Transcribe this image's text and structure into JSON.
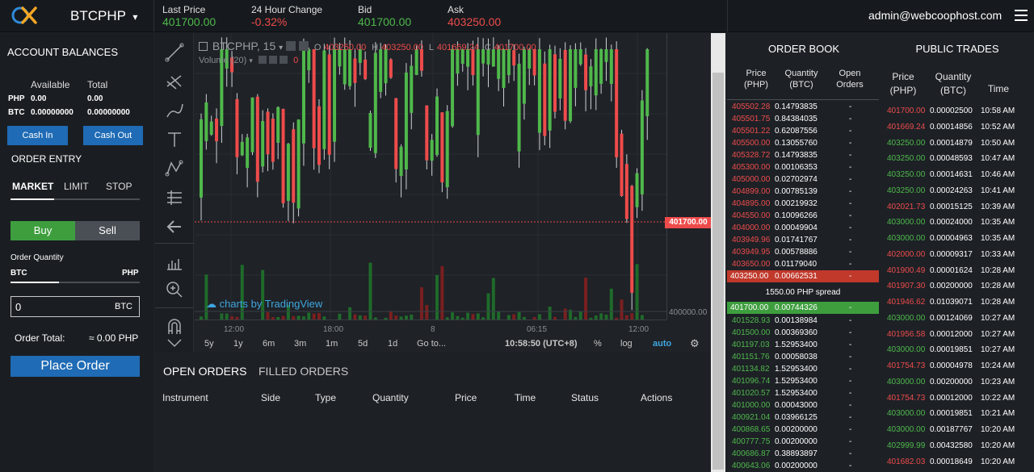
{
  "header": {
    "pair": "BTCPHP",
    "caret": "▾",
    "last_price_label": "Last Price",
    "last_price": "401700.00",
    "change_label": "24 Hour Change",
    "change": "-0.32%",
    "bid_label": "Bid",
    "bid": "401700.00",
    "ask_label": "Ask",
    "ask": "403250.00",
    "user": "admin@webcoophost.com"
  },
  "balances": {
    "title": "ACCOUNT BALANCES",
    "col_available": "Available",
    "col_total": "Total",
    "rows": [
      {
        "asset": "PHP",
        "available": "0.00",
        "total": "0.00"
      },
      {
        "asset": "BTC",
        "available": "0.00000000",
        "total": "0.00000000"
      }
    ],
    "cash_in": "Cash In",
    "cash_out": "Cash Out"
  },
  "order_entry": {
    "title": "ORDER ENTRY",
    "tabs": [
      "MARKET",
      "LIMIT",
      "STOP"
    ],
    "buy": "Buy",
    "sell": "Sell",
    "qty_label": "Order Quantity",
    "from": "BTC",
    "to": "PHP",
    "qty_value": "0",
    "qty_unit": "BTC",
    "total_label": "Order Total:",
    "total_value": "≈ 0.00 PHP",
    "place": "Place Order"
  },
  "chart": {
    "symbol": "BTCPHP, 15",
    "ohlc": {
      "o_label": "O",
      "o": "403250.00",
      "h_label": "H",
      "h": "403250.00",
      "l_label": "L",
      "l": "401669.24",
      "c_label": "C",
      "c": "401700.00"
    },
    "volume_label": "Volume (20)",
    "volume_value": "0",
    "last_price_tag": "401700.00",
    "scale_label": "400000.00",
    "time_labels": [
      "12:00",
      "18:00",
      "8",
      "06:15",
      "12:00"
    ],
    "ranges": [
      "5y",
      "1y",
      "6m",
      "3m",
      "1m",
      "5d",
      "1d",
      "Go to..."
    ],
    "clock": "10:58:50 (UTC+8)",
    "pct": "%",
    "log": "log",
    "auto": "auto",
    "watermark": "charts by TradingView"
  },
  "chart_colors": {
    "up": "#4fb84b",
    "down": "#ee4b4b"
  },
  "orders": {
    "tabs": [
      "OPEN ORDERS",
      "FILLED ORDERS"
    ],
    "columns": [
      "Instrument",
      "Side",
      "Type",
      "Quantity",
      "Price",
      "Time",
      "Status",
      "Actions"
    ]
  },
  "order_book": {
    "title": "ORDER BOOK",
    "columns": [
      "Price\n(PHP)",
      "Quantity\n(BTC)",
      "Open\nOrders"
    ],
    "asks": [
      {
        "price": "405502.28",
        "qty": "0.14793835",
        "open": "-"
      },
      {
        "price": "405501.75",
        "qty": "0.84384035",
        "open": "-"
      },
      {
        "price": "405501.22",
        "qty": "0.62087556",
        "open": "-"
      },
      {
        "price": "405500.00",
        "qty": "0.13055760",
        "open": "-"
      },
      {
        "price": "405328.72",
        "qty": "0.14793835",
        "open": "-"
      },
      {
        "price": "405300.00",
        "qty": "0.00106353",
        "open": "-"
      },
      {
        "price": "405000.00",
        "qty": "0.02702974",
        "open": "-"
      },
      {
        "price": "404899.00",
        "qty": "0.00785139",
        "open": "-"
      },
      {
        "price": "404895.00",
        "qty": "0.00219932",
        "open": "-"
      },
      {
        "price": "404550.00",
        "qty": "0.10096266",
        "open": "-"
      },
      {
        "price": "404000.00",
        "qty": "0.00049904",
        "open": "-"
      },
      {
        "price": "403949.96",
        "qty": "0.01741767",
        "open": "-"
      },
      {
        "price": "403949.95",
        "qty": "0.00578886",
        "open": "-"
      },
      {
        "price": "403650.00",
        "qty": "0.01179040",
        "open": "-"
      }
    ],
    "best_ask": {
      "price": "403250.00",
      "qty": "0.00662531",
      "open": "-"
    },
    "spread": "1550.00 PHP spread",
    "best_bid": {
      "price": "401700.00",
      "qty": "0.00744326",
      "open": "-"
    },
    "bids": [
      {
        "price": "401528.93",
        "qty": "0.00138984",
        "open": "-"
      },
      {
        "price": "401500.00",
        "qty": "0.00369360",
        "open": "-"
      },
      {
        "price": "401197.03",
        "qty": "1.52953400",
        "open": "-"
      },
      {
        "price": "401151.76",
        "qty": "0.00058038",
        "open": "-"
      },
      {
        "price": "401134.82",
        "qty": "1.52953400",
        "open": "-"
      },
      {
        "price": "401096.74",
        "qty": "1.52953400",
        "open": "-"
      },
      {
        "price": "401020.57",
        "qty": "1.52953400",
        "open": "-"
      },
      {
        "price": "401000.00",
        "qty": "0.00043000",
        "open": "-"
      },
      {
        "price": "400921.04",
        "qty": "0.03966125",
        "open": "-"
      },
      {
        "price": "400868.65",
        "qty": "0.00200000",
        "open": "-"
      },
      {
        "price": "400777.75",
        "qty": "0.00200000",
        "open": "-"
      },
      {
        "price": "400686.87",
        "qty": "0.38893897",
        "open": "-"
      },
      {
        "price": "400643.06",
        "qty": "0.00200000",
        "open": "-"
      }
    ]
  },
  "public_trades": {
    "title": "PUBLIC TRADES",
    "columns": [
      "Price\n(PHP)",
      "Quantity\n(BTC)",
      "Time"
    ],
    "rows": [
      {
        "price": "401700.00",
        "qty": "0.00002500",
        "time": "10:58 AM",
        "side": "sell"
      },
      {
        "price": "401669.24",
        "qty": "0.00014856",
        "time": "10:52 AM",
        "side": "sell"
      },
      {
        "price": "403250.00",
        "qty": "0.00014879",
        "time": "10:50 AM",
        "side": "buy"
      },
      {
        "price": "403250.00",
        "qty": "0.00048593",
        "time": "10:47 AM",
        "side": "buy"
      },
      {
        "price": "403250.00",
        "qty": "0.00014631",
        "time": "10:46 AM",
        "side": "buy"
      },
      {
        "price": "403250.00",
        "qty": "0.00024263",
        "time": "10:41 AM",
        "side": "buy"
      },
      {
        "price": "402021.73",
        "qty": "0.00015125",
        "time": "10:39 AM",
        "side": "sell"
      },
      {
        "price": "403000.00",
        "qty": "0.00024000",
        "time": "10:35 AM",
        "side": "buy"
      },
      {
        "price": "403000.00",
        "qty": "0.00004963",
        "time": "10:35 AM",
        "side": "buy"
      },
      {
        "price": "402000.00",
        "qty": "0.00009317",
        "time": "10:33 AM",
        "side": "sell"
      },
      {
        "price": "401900.49",
        "qty": "0.00001624",
        "time": "10:28 AM",
        "side": "sell"
      },
      {
        "price": "401907.30",
        "qty": "0.00200000",
        "time": "10:28 AM",
        "side": "sell"
      },
      {
        "price": "401946.62",
        "qty": "0.01039071",
        "time": "10:28 AM",
        "side": "sell"
      },
      {
        "price": "403000.00",
        "qty": "0.00124069",
        "time": "10:27 AM",
        "side": "buy"
      },
      {
        "price": "401956.58",
        "qty": "0.00012000",
        "time": "10:27 AM",
        "side": "sell"
      },
      {
        "price": "403000.00",
        "qty": "0.00019851",
        "time": "10:27 AM",
        "side": "buy"
      },
      {
        "price": "401754.73",
        "qty": "0.00004978",
        "time": "10:24 AM",
        "side": "sell"
      },
      {
        "price": "403000.00",
        "qty": "0.00200000",
        "time": "10:23 AM",
        "side": "buy"
      },
      {
        "price": "401754.73",
        "qty": "0.00012000",
        "time": "10:22 AM",
        "side": "sell"
      },
      {
        "price": "403000.00",
        "qty": "0.00019851",
        "time": "10:21 AM",
        "side": "buy"
      },
      {
        "price": "403000.00",
        "qty": "0.00187767",
        "time": "10:20 AM",
        "side": "buy"
      },
      {
        "price": "402999.99",
        "qty": "0.00432580",
        "time": "10:20 AM",
        "side": "buy"
      },
      {
        "price": "401682.03",
        "qty": "0.00018649",
        "time": "10:20 AM",
        "side": "sell"
      }
    ]
  }
}
